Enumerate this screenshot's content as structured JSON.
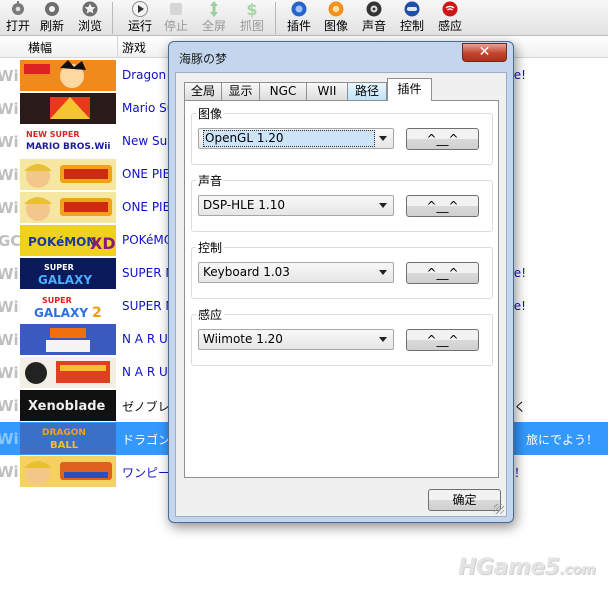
{
  "toolbar": {
    "buttons": [
      {
        "label": "打开",
        "icon": "open-icon",
        "enabled": true
      },
      {
        "label": "刷新",
        "icon": "refresh-icon",
        "enabled": true
      },
      {
        "label": "浏览",
        "icon": "browse-icon",
        "enabled": true
      },
      {
        "label": "运行",
        "icon": "play-icon",
        "enabled": true
      },
      {
        "label": "停止",
        "icon": "stop-icon",
        "enabled": false
      },
      {
        "label": "全屏",
        "icon": "fullscreen-icon",
        "enabled": false
      },
      {
        "label": "抓图",
        "icon": "screenshot-icon",
        "enabled": false
      },
      {
        "label": "插件",
        "icon": "plugin-icon",
        "enabled": true
      },
      {
        "label": "图像",
        "icon": "graphics-icon",
        "enabled": true
      },
      {
        "label": "声音",
        "icon": "sound-icon",
        "enabled": true
      },
      {
        "label": "控制",
        "icon": "controller-icon",
        "enabled": true
      },
      {
        "label": "感应",
        "icon": "wiimote-icon",
        "enabled": true
      }
    ]
  },
  "list": {
    "columns": [
      "横幅",
      "游戏"
    ],
    "rows": [
      {
        "platform": "Wii",
        "banner": "dragonball",
        "title": "Dragon",
        "tail": "e!",
        "selected": false
      },
      {
        "platform": "Wii",
        "banner": "mario-strikers",
        "title": "Mario Su",
        "tail": "",
        "selected": false
      },
      {
        "platform": "Wii",
        "banner": "nsmb-wii",
        "title": "New Sup",
        "tail": "",
        "selected": false
      },
      {
        "platform": "Wii",
        "banner": "onepiece-cruise",
        "title": "ONE PIE",
        "tail": "",
        "selected": false
      },
      {
        "platform": "Wii",
        "banner": "onepiece-cruise",
        "title": "ONE PIE",
        "tail": "",
        "selected": false
      },
      {
        "platform": "GC",
        "banner": "pokemon-xd",
        "title": "POKéMO",
        "tail": "",
        "selected": false
      },
      {
        "platform": "Wii",
        "banner": "mario-galaxy",
        "title": "SUPER M",
        "tail": "venture!",
        "selected": false
      },
      {
        "platform": "Wii",
        "banner": "mario-galaxy-2",
        "title": "SUPER M",
        "tail": "ture!",
        "selected": false
      },
      {
        "platform": "Wii",
        "banner": "naruto",
        "title": "N A R U",
        "tail": "",
        "selected": false
      },
      {
        "platform": "Wii",
        "banner": "naruto-ex",
        "title": "N A R U",
        "tail": "",
        "selected": false
      },
      {
        "platform": "Wii",
        "banner": "xenoblade",
        "title": "ゼノブレ",
        "tail": "を斬り開く",
        "selected": false,
        "black": true
      },
      {
        "platform": "Wii",
        "banner": "dragonball-adventure",
        "title": "ドラゴン",
        "tail": "旅にでよう！",
        "selected": true
      },
      {
        "platform": "Wii",
        "banner": "onepiece-adventure",
        "title": "ワンピー",
        "tail": "る大冒険！",
        "selected": false
      }
    ]
  },
  "dialog": {
    "title": "海豚の梦",
    "close": "✕",
    "tabs": [
      "全局",
      "显示",
      "NGC",
      "WII",
      "路径",
      "插件"
    ],
    "active_tab": "插件",
    "hover_tab": "路径",
    "groups": [
      {
        "label": "图像",
        "value": "OpenGL 1.20",
        "button": "^__^"
      },
      {
        "label": "声音",
        "value": "DSP-HLE 1.10",
        "button": "^__^"
      },
      {
        "label": "控制",
        "value": "Keyboard 1.03",
        "button": "^__^"
      },
      {
        "label": "感应",
        "value": "Wiimote 1.20",
        "button": "^__^"
      }
    ],
    "ok": "确定"
  },
  "watermark": {
    "text": "HGame5",
    "suffix": ".com"
  },
  "colors": {
    "selection": "#3399ff",
    "link": "#1010c8",
    "close": "#c4432c"
  }
}
